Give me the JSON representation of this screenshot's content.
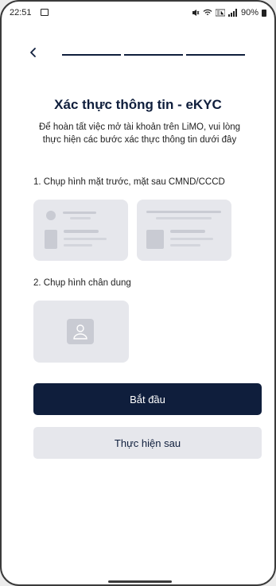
{
  "status_bar": {
    "time": "22:51",
    "battery": "90%",
    "icons": [
      "gallery-icon",
      "mute-icon",
      "wifi-icon",
      "volte-icon",
      "signal-icon",
      "battery-icon"
    ]
  },
  "progress": {
    "steps_total": 3,
    "steps_done": 3
  },
  "title": "Xác thực thông tin - eKYC",
  "subtitle": "Để hoàn tất việc mở tài khoản trên LiMO, vui lòng thực hiện các bước xác thực thông tin dưới đây",
  "step1": {
    "label": "1. Chụp hình mặt trước, mặt sau CMND/CCCD"
  },
  "step2": {
    "label": "2. Chụp hình chân dung"
  },
  "buttons": {
    "start": "Bắt đầu",
    "later": "Thực hiện sau"
  },
  "colors": {
    "primary": "#0f1e3c",
    "card": "#e6e7ec",
    "placeholder": "#c9cbd3"
  }
}
